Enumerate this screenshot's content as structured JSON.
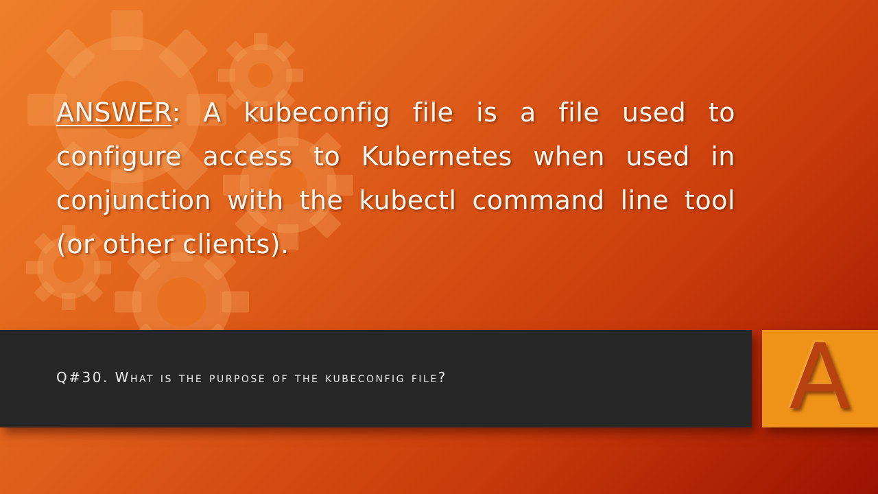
{
  "answer": {
    "label": "ANSWER",
    "separator": ":",
    "text": " A kubeconfig file is a file used to configure access to Kubernetes when used in conjunction with the kubectl command line tool (or other clients)."
  },
  "question": {
    "text": "Q#30. What is the purpose of the kubeconfig file?"
  },
  "badge": {
    "letter": "A"
  },
  "colors": {
    "background_light": "#ee7f2a",
    "background_dark": "#9c1202",
    "question_bar": "#262626",
    "badge": "#ee9318",
    "badge_letter": "#b7420f"
  },
  "decorations": {
    "background_icon": "gear-icon"
  }
}
